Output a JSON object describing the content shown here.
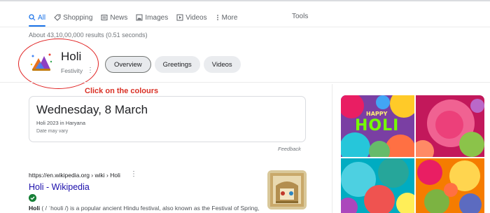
{
  "tabs": [
    {
      "label": "All",
      "icon": "search-icon",
      "active": true
    },
    {
      "label": "Shopping",
      "icon": "tag-icon"
    },
    {
      "label": "News",
      "icon": "news-icon"
    },
    {
      "label": "Images",
      "icon": "image-icon"
    },
    {
      "label": "Videos",
      "icon": "play-icon"
    },
    {
      "label": "More",
      "icon": "kebab-icon"
    }
  ],
  "tools_label": "Tools",
  "result_stats": "About 43,10,00,000 results (0.51 seconds)",
  "entity": {
    "title": "Holi",
    "subtitle": "Festivity",
    "chips": [
      "Overview",
      "Greetings",
      "Videos"
    ]
  },
  "annotation": "Click on the colours",
  "date_card": {
    "date": "Wednesday, 8 March",
    "subtitle": "Holi 2023 in Haryana",
    "note": "Date may vary",
    "feedback": "Feedback"
  },
  "result": {
    "url": "https://en.wikipedia.org › wiki › Holi",
    "title": "Holi - Wikipedia",
    "snippet_bold": "Holi",
    "snippet_rest": " ( / ˈhoʊli /) is a popular ancient Hindu festival, also known as the Festival of Spring,"
  },
  "images": {
    "overlay_top": "HAPPY",
    "overlay_main": "HOLI"
  },
  "colors": {
    "link": "#1a0dab",
    "accent": "#1a73e8",
    "annotation": "#d93025"
  }
}
